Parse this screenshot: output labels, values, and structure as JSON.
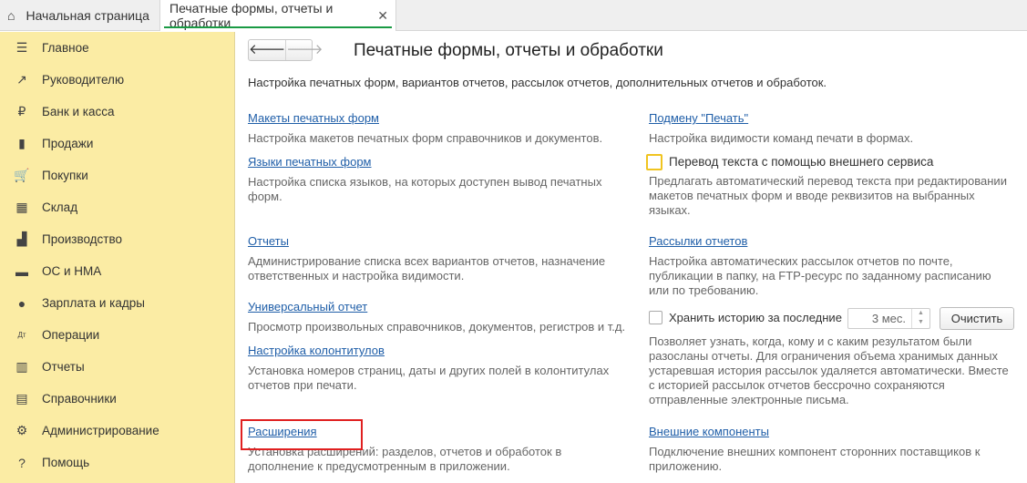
{
  "tabs": {
    "home": "Начальная страница",
    "active": "Печатные формы, отчеты и обработки"
  },
  "sidebar": [
    {
      "icon": "menu-icon",
      "glyph": "☰",
      "label": "Главное"
    },
    {
      "icon": "trend-icon",
      "glyph": "↗",
      "label": "Руководителю"
    },
    {
      "icon": "ruble-icon",
      "glyph": "₽",
      "label": "Банк и касса"
    },
    {
      "icon": "bag-icon",
      "glyph": "▮",
      "label": "Продажи"
    },
    {
      "icon": "cart-icon",
      "glyph": "🛒",
      "label": "Покупки"
    },
    {
      "icon": "warehouse-icon",
      "glyph": "▦",
      "label": "Склад"
    },
    {
      "icon": "factory-icon",
      "glyph": "▟",
      "label": "Производство"
    },
    {
      "icon": "truck-icon",
      "glyph": "▬",
      "label": "ОС и НМА"
    },
    {
      "icon": "person-icon",
      "glyph": "●",
      "label": "Зарплата и кадры"
    },
    {
      "icon": "debit-credit-icon",
      "glyph": "Дт",
      "label": "Операции"
    },
    {
      "icon": "bar-chart-icon",
      "glyph": "▥",
      "label": "Отчеты"
    },
    {
      "icon": "books-icon",
      "glyph": "▤",
      "label": "Справочники"
    },
    {
      "icon": "gear-icon",
      "glyph": "⚙",
      "label": "Администрирование"
    },
    {
      "icon": "help-icon",
      "glyph": "?",
      "label": "Помощь"
    }
  ],
  "page": {
    "title": "Печатные формы, отчеты и обработки",
    "intro": "Настройка печатных форм, вариантов отчетов, рассылок отчетов, дополнительных отчетов и обработок."
  },
  "left": [
    {
      "link": "Макеты печатных форм",
      "desc": "Настройка макетов печатных форм справочников и документов."
    },
    {
      "link": "Языки печатных форм",
      "desc": "Настройка списка языков, на которых доступен вывод печатных форм."
    },
    {
      "link": "Отчеты",
      "desc": "Администрирование списка всех вариантов отчетов, назначение ответственных и настройка видимости."
    },
    {
      "link": "Универсальный отчет",
      "desc": "Просмотр произвольных справочников, документов, регистров и т.д."
    },
    {
      "link": "Настройка колонтитулов",
      "desc": "Установка номеров страниц, даты и других полей в колонтитулах отчетов при печати."
    },
    {
      "link": "Расширения",
      "desc": "Установка расширений: разделов, отчетов и обработок в дополнение к предусмотренным в приложении."
    }
  ],
  "right": {
    "print_link": "Подмену \"Печать\"",
    "print_desc": "Настройка видимости команд печати в формах.",
    "translate_label": "Перевод текста с помощью внешнего сервиса",
    "translate_desc": "Предлагать автоматический перевод текста при редактировании макетов печатных форм и вводе реквизитов на выбранных языках.",
    "mail_link": "Рассылки отчетов",
    "mail_desc": "Настройка автоматических рассылок отчетов по почте, публикации в папку, на FTP-ресурс по заданному расписанию или по требованию.",
    "history_label": "Хранить историю за последние",
    "history_value": "3 мес.",
    "clear_button": "Очистить",
    "history_desc": "Позволяет узнать, когда, кому и с каким результатом были разосланы отчеты. Для ограничения объема хранимых данных устаревшая история рассылок удаляется автоматически. Вместе с историей рассылок отчетов бессрочно сохраняются отправленные электронные письма.",
    "ext_link": "Внешние компоненты",
    "ext_desc": "Подключение внешних компонент сторонних поставщиков к приложению."
  }
}
